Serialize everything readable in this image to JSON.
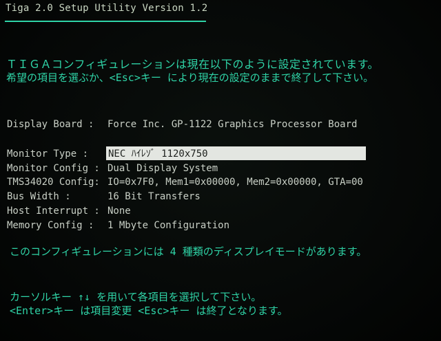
{
  "header": {
    "title": "Tiga 2.0 Setup Utility Version 1.2"
  },
  "intro": {
    "line1": "ＴＩＧＡコンフィギュレーションは現在以下のように設定されています。",
    "line2": "希望の項目を選ぶか、<Esc>キー により現在の設定のままで終了して下さい。"
  },
  "display_board": {
    "label": "Display Board  : ",
    "value": "Force Inc. GP-1122 Graphics Processor Board"
  },
  "fields": [
    {
      "label": "Monitor Type   : ",
      "value": "NEC ﾊｲﾚｿﾞ 1120x750",
      "selected": true
    },
    {
      "label": "Monitor Config : ",
      "value": "Dual Display System"
    },
    {
      "label": "TMS34020 Config: ",
      "value": "IO=0x7F0, Mem1=0x00000, Mem2=0x00000, GTA=00"
    },
    {
      "label": "Bus Width      : ",
      "value": "16 Bit Transfers"
    },
    {
      "label": "Host Interrupt : ",
      "value": "None"
    },
    {
      "label": "Memory Config  : ",
      "value": "1 Mbyte Configuration"
    }
  ],
  "modes_message": "このコンフィギュレーションには 4 種類のディスプレイモードがあります。",
  "help": {
    "line1": "カーソルキー ↑↓ を用いて各項目を選択して下さい。",
    "line2": "<Enter>キー は項目変更 <Esc>キー は終了となります。"
  },
  "colors": {
    "background": "#050807",
    "accent_cyan": "#2fd4a7",
    "text_white": "#c9d0c6",
    "highlight_bg": "#e3e6e1"
  }
}
